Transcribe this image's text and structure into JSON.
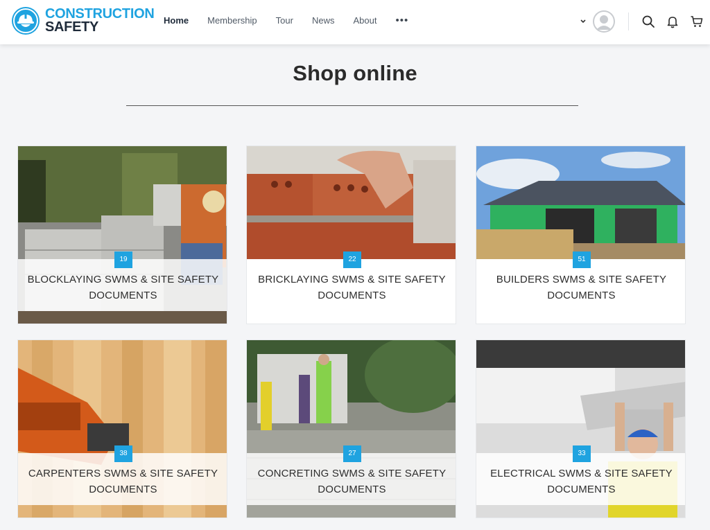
{
  "brand": {
    "line1": "CONSTRUCTION",
    "line2": "SAFETY"
  },
  "nav": {
    "items": [
      {
        "label": "Home"
      },
      {
        "label": "Membership"
      },
      {
        "label": "Tour"
      },
      {
        "label": "News"
      },
      {
        "label": "About"
      }
    ],
    "more": "•••"
  },
  "header_icons": [
    "chevron-down-icon",
    "avatar",
    "search-icon",
    "bell-icon",
    "cart-icon"
  ],
  "page": {
    "title": "Shop online"
  },
  "cards": [
    {
      "count": "19",
      "title_line1": "BLOCKLAYING SWMS & SITE SAFETY",
      "title_line2": "DOCUMENTS"
    },
    {
      "count": "22",
      "title_line1": "BRICKLAYING SWMS & SITE SAFETY",
      "title_line2": "DOCUMENTS"
    },
    {
      "count": "51",
      "title_line1": "BUILDERS SWMS & SITE SAFETY",
      "title_line2": "DOCUMENTS"
    },
    {
      "count": "38",
      "title_line1": "CARPENTERS SWMS & SITE SAFETY",
      "title_line2": "DOCUMENTS"
    },
    {
      "count": "27",
      "title_line1": "CONCRETING SWMS & SITE SAFETY",
      "title_line2": "DOCUMENTS"
    },
    {
      "count": "33",
      "title_line1": "ELECTRICAL SWMS & SITE SAFETY",
      "title_line2": "DOCUMENTS"
    }
  ],
  "colors": {
    "accent": "#1fa3e0",
    "dark": "#1f2b3a",
    "background": "#f4f5f7"
  }
}
